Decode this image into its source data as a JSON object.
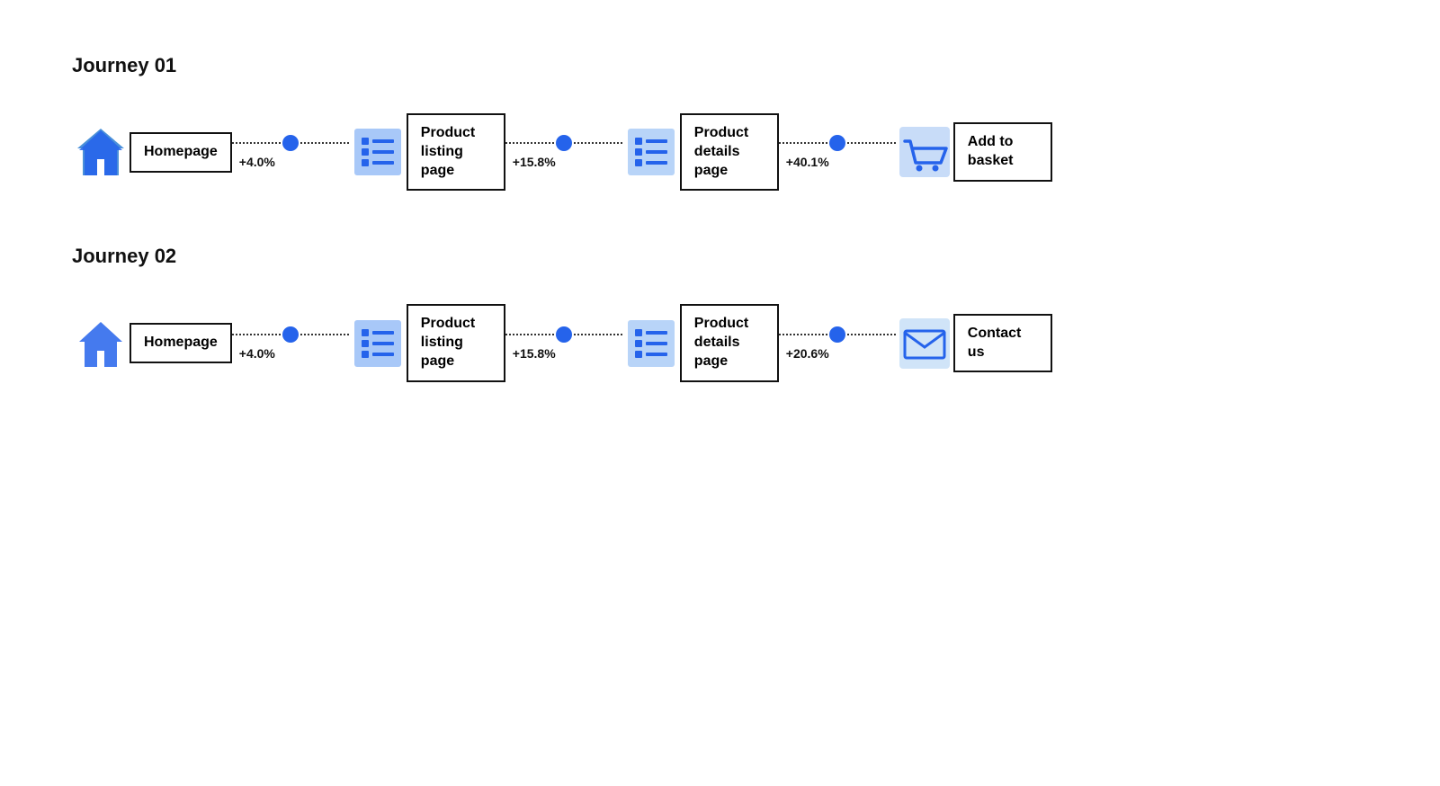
{
  "journeys": [
    {
      "id": "journey-01",
      "title": "Journey 01",
      "steps": [
        {
          "icon": "home",
          "label": "Homepage",
          "multi_line": false
        },
        {
          "connector_percent": "+4.0%"
        },
        {
          "icon": "listing",
          "label": "Product listing page",
          "multi_line": true
        },
        {
          "connector_percent": "+15.8%"
        },
        {
          "icon": "listing",
          "label": "Product details page",
          "multi_line": true
        },
        {
          "connector_percent": "+40.1%"
        },
        {
          "icon": "cart",
          "label": "Add to basket",
          "multi_line": true
        }
      ]
    },
    {
      "id": "journey-02",
      "title": "Journey 02",
      "steps": [
        {
          "icon": "home",
          "label": "Homepage",
          "multi_line": false
        },
        {
          "connector_percent": "+4.0%"
        },
        {
          "icon": "listing",
          "label": "Product listing page",
          "multi_line": true
        },
        {
          "connector_percent": "+15.8%"
        },
        {
          "icon": "listing",
          "label": "Product details page",
          "multi_line": true
        },
        {
          "connector_percent": "+20.6%"
        },
        {
          "icon": "envelope",
          "label": "Contact us",
          "multi_line": true
        }
      ]
    }
  ]
}
